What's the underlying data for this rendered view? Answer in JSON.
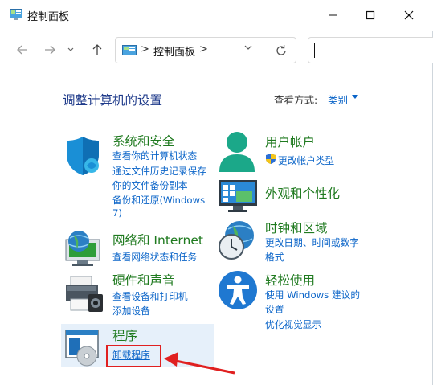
{
  "window": {
    "title": "控制面板",
    "controls": {
      "minimize": "minimize-icon",
      "maximize": "maximize-icon",
      "close": "close-icon"
    }
  },
  "address": {
    "separator": ">",
    "path_label": "控制面板",
    "trailing_separator": ">",
    "search_placeholder": ""
  },
  "header": {
    "title": "调整计算机的设置",
    "viewby_label": "查看方式:",
    "viewby_value": "类别"
  },
  "left_categories": [
    {
      "title": "系统和安全",
      "links": [
        "查看你的计算机状态",
        "通过文件历史记录保存",
        "你的文件备份副本",
        "备份和还原(Windows",
        "7)"
      ]
    },
    {
      "title": "网络和 Internet",
      "links": [
        "查看网络状态和任务"
      ]
    },
    {
      "title": "硬件和声音",
      "links": [
        "查看设备和打印机",
        "添加设备"
      ]
    },
    {
      "title": "程序",
      "links": [
        "卸载程序"
      ]
    }
  ],
  "right_categories": [
    {
      "title": "用户帐户",
      "links": [
        "更改帐户类型"
      ]
    },
    {
      "title": "外观和个性化",
      "links": []
    },
    {
      "title": "时钟和区域",
      "links": [
        "更改日期、时间或数字",
        "格式"
      ]
    },
    {
      "title": "轻松使用",
      "links": [
        "使用 Windows 建议的",
        "设置",
        "优化视觉显示"
      ]
    }
  ],
  "colors": {
    "category_title": "#1f7a1f",
    "link": "#0a64c8",
    "heading": "#1e3a8a",
    "annotation": "#e02020"
  }
}
